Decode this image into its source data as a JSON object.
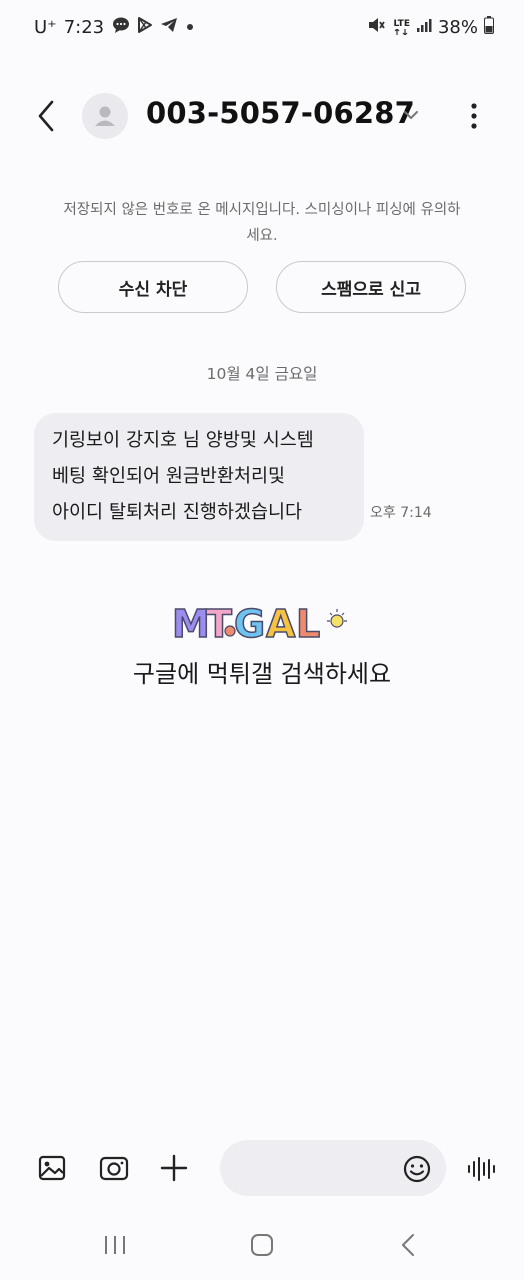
{
  "status_bar": {
    "carrier": "U⁺",
    "time": "7:23",
    "left_icons": [
      "chat-bubble-icon",
      "play-store-icon",
      "telegram-icon",
      "dot-icon"
    ],
    "right_icons": [
      "mute-icon",
      "lte-icon",
      "signal-icon",
      "battery-icon"
    ],
    "lte_label": "LTE",
    "battery": "38%"
  },
  "header": {
    "contact_name": "003-5057-06287",
    "back_icon": "chevron-left-icon",
    "avatar_icon": "person-icon",
    "expand_icon": "chevron-down-icon",
    "more_icon": "more-vertical-icon"
  },
  "notice": {
    "text": "저장되지 않은 번호로 온 메시지입니다. 스미싱이나 피싱에 유의하세요."
  },
  "actions": {
    "block_label": "수신 차단",
    "spam_label": "스팸으로 신고"
  },
  "conversation": {
    "date_label": "10월 4일 금요일",
    "messages": [
      {
        "lines": [
          "기링보이 강지호 님 양방및 시스템",
          "베팅 확인되어 원금반환처리및",
          "아이디 탈퇴처리 진행하겠습니다"
        ],
        "time": "오후 7:14"
      }
    ]
  },
  "ad": {
    "logo_text": "MTGAL",
    "caption": "구글에 먹튀갤 검색하세요",
    "logo_colors": [
      "#9b8cf0",
      "#f2a6c8",
      "#6fc3f0",
      "#f5c242",
      "#f08a6c"
    ]
  },
  "composer": {
    "icons": [
      "gallery-icon",
      "camera-icon",
      "plus-icon",
      "emoji-icon",
      "voice-waveform-icon"
    ]
  },
  "navbar": {
    "icons": [
      "recent-apps-icon",
      "home-icon",
      "back-nav-icon"
    ]
  }
}
